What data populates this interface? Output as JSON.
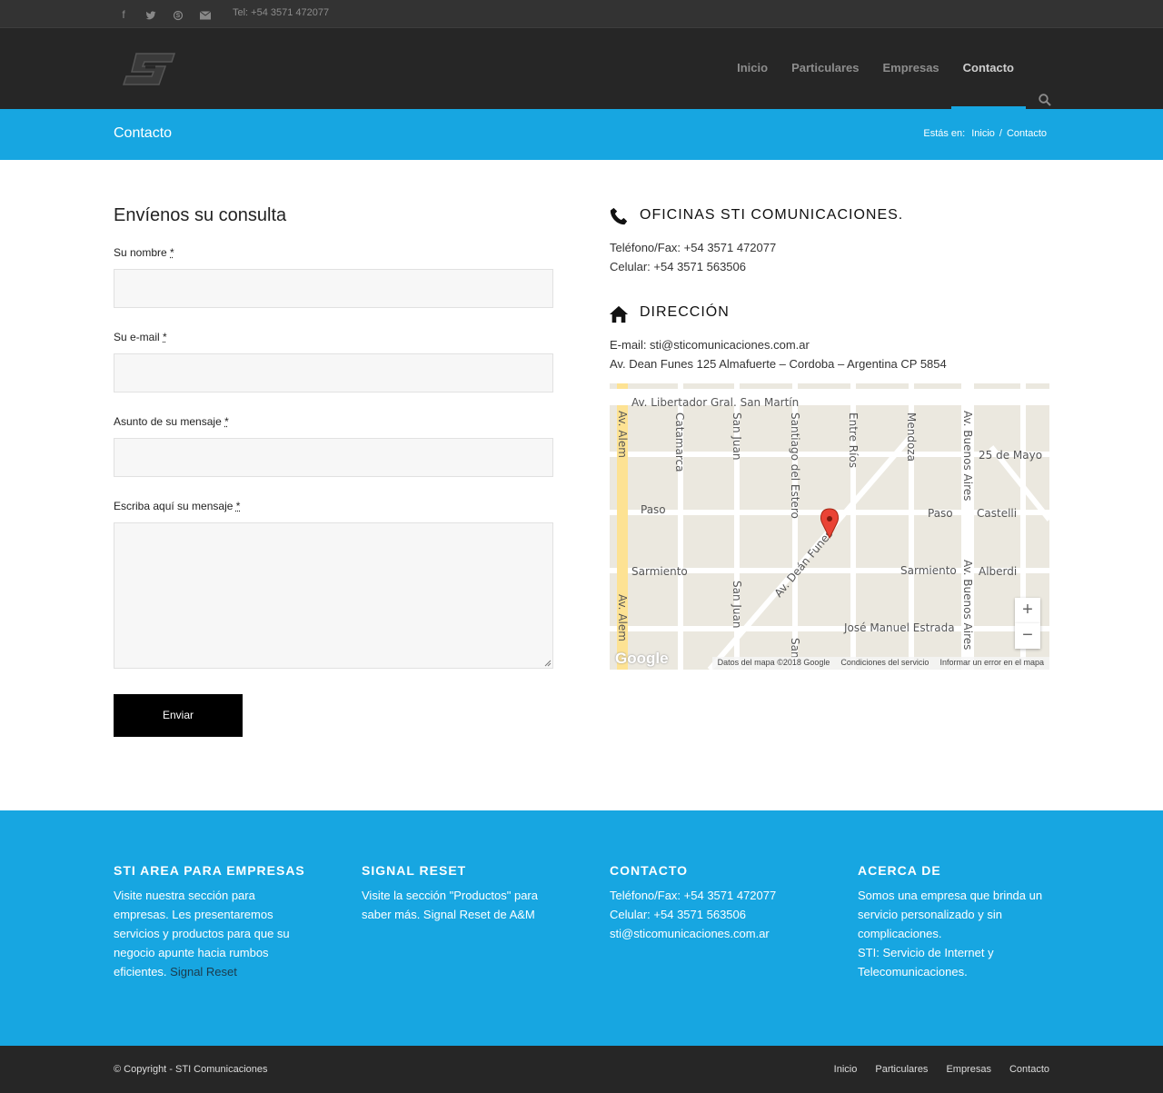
{
  "topbar": {
    "social_icons": [
      "facebook-icon",
      "twitter-icon",
      "skype-icon",
      "mail-icon"
    ],
    "tel": "Tel: +54 3571 472077"
  },
  "nav": {
    "items": [
      "Inicio",
      "Particulares",
      "Empresas",
      "Contacto"
    ],
    "active": "Contacto"
  },
  "titlebar": {
    "title": "Contacto",
    "crumb_prefix": "Estás en:",
    "crumb_home": "Inicio",
    "crumb_sep": "/",
    "crumb_current": "Contacto"
  },
  "form": {
    "title": "Envíenos su consulta",
    "name_label": "Su nombre",
    "email_label": "Su e-mail",
    "subject_label": "Asunto de su mensaje",
    "message_label": "Escriba aquí su mensaje",
    "required_mark": "*",
    "send_label": "Enviar"
  },
  "info": {
    "offices_title": "OFICINAS STI COMUNICACIONES.",
    "phone": "Teléfono/Fax: +54 3571 472077",
    "cell": "Celular: +54 3571 563506",
    "address_title": "DIRECCIÓN",
    "email": "E-mail: sti@sticomunicaciones.com.ar",
    "address": "Av. Dean Funes 125 Almafuerte – Cordoba – Argentina CP 5854"
  },
  "map": {
    "streets": {
      "libertador": "Av. Libertador Gral. San Martín",
      "alem": "Av. Alem",
      "catamarca": "Catamarca",
      "san_juan": "San Juan",
      "santiago": "Santiago del Estero",
      "entre_rios": "Entre Ríos",
      "mendoza": "Mendoza",
      "buenos_aires": "Av. Buenos Aires",
      "mayo": "25 de Mayo",
      "paso": "Paso",
      "castelli": "Castelli",
      "sarmiento": "Sarmiento",
      "alberdi": "Alberdi",
      "dean_funes": "Av. Deán Funes",
      "estrada": "José Manuel Estrada",
      "san_short": "San"
    },
    "zoom_in": "+",
    "zoom_out": "−",
    "google": "Google",
    "attr_data": "Datos del mapa ©2018 Google",
    "attr_terms": "Condiciones del servicio",
    "attr_report": "Informar un error en el mapa"
  },
  "footer": {
    "col1": {
      "title": "STI AREA PARA EMPRESAS",
      "text": "Visite nuestra sección para empresas. Les presentaremos servicios y productos para que su negocio apunte hacia rumbos eficientes.",
      "link": "Signal Reset"
    },
    "col2": {
      "title": "SIGNAL RESET",
      "text": "Visite la sección \"Productos\" para saber más. Signal Reset de A&M"
    },
    "col3": {
      "title": "CONTACTO",
      "phone": "Teléfono/Fax: +54 3571 472077",
      "cell": "Celular: +54 3571 563506",
      "email": "sti@sticomunicaciones.com.ar"
    },
    "col4": {
      "title": "ACERCA DE",
      "text1": "Somos una empresa que brinda un servicio personalizado y sin complicaciones.",
      "text2": "STI: Servicio de Internet y Telecomunicaciones."
    }
  },
  "bottombar": {
    "copyright": "© Copyright - STI Comunicaciones",
    "links": [
      "Inicio",
      "Particulares",
      "Empresas",
      "Contacto"
    ]
  },
  "colors": {
    "accent": "#17a6e1",
    "header_bg": "#262626",
    "topbar_bg": "#333333"
  }
}
